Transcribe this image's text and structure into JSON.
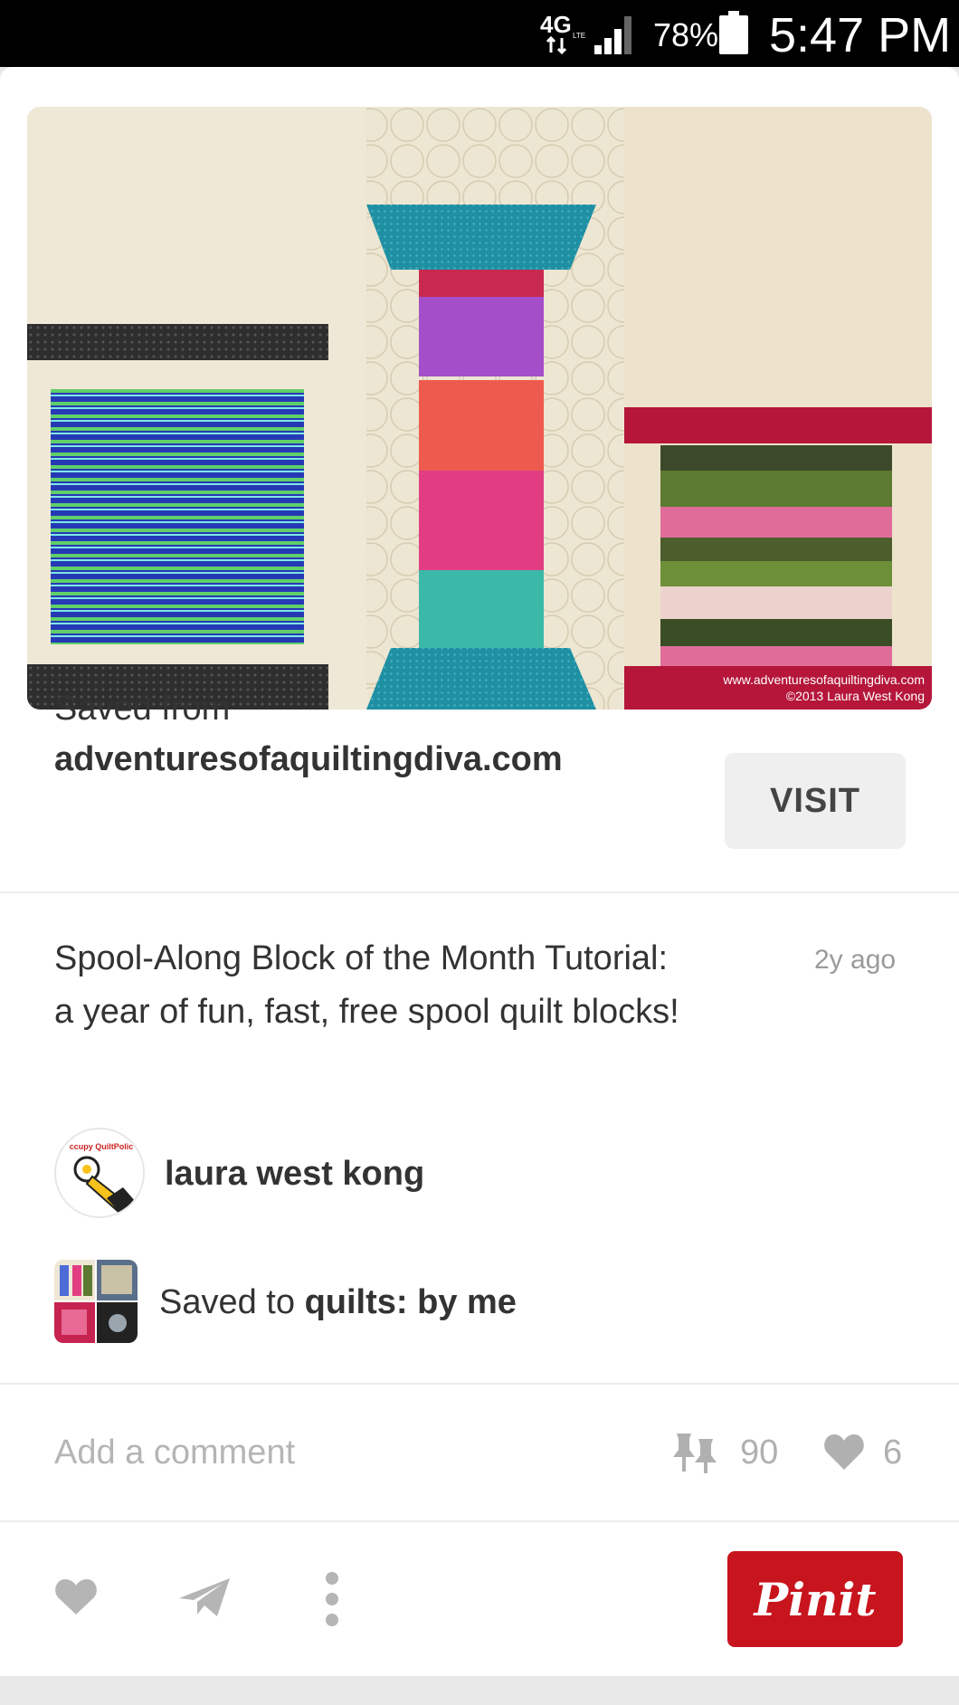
{
  "status_bar": {
    "network": "4G",
    "network_sub": "LTE",
    "battery_percent": "78%",
    "time": "5:47 PM"
  },
  "pin": {
    "image_credit_line1": "www.adventuresofaquiltingdiva.com",
    "image_credit_line2": "©2013 Laura West Kong",
    "saved_from_label": "Saved from",
    "source_domain": "adventuresofaquiltingdiva.com",
    "visit_label": "VISIT",
    "description": "Spool-Along Block of the Month Tutorial: a year of fun, fast, free spool quilt blocks!",
    "time_ago": "2y ago",
    "author_name": "laura west kong",
    "avatar_text": "ccupy QuiltPolic",
    "saved_to_prefix": "Saved to ",
    "board_name": "quilts: by me"
  },
  "engagement": {
    "comment_placeholder": "Add a comment",
    "repin_count": "90",
    "like_count": "6"
  },
  "actions": {
    "pinit_label": "Pinit"
  },
  "colors": {
    "pinterest_red": "#c8141d"
  }
}
